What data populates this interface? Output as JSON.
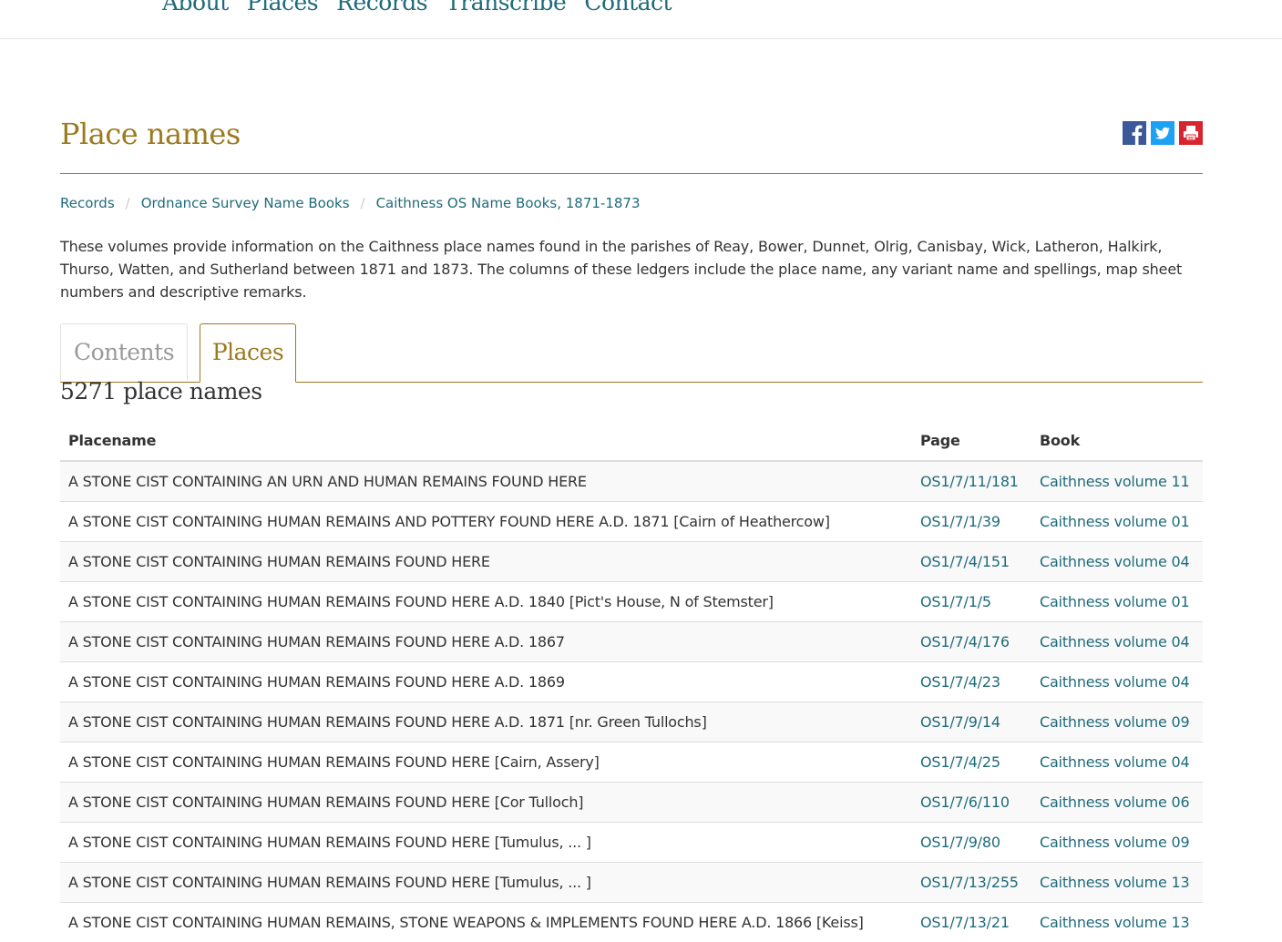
{
  "nav": [
    "About",
    "Places",
    "Records",
    "Transcribe",
    "Contact"
  ],
  "page_title": "Place names",
  "share_icons": [
    "facebook-icon",
    "twitter-icon",
    "print-icon"
  ],
  "colors": {
    "accent": "#9c7a1f",
    "link": "#1f6b7b",
    "facebook": "#3b5998",
    "twitter": "#1da1f2",
    "print": "#d9232e"
  },
  "breadcrumb": [
    "Records",
    "Ordnance Survey Name Books",
    "Caithness OS Name Books, 1871-1873"
  ],
  "intro": "These volumes provide information on the Caithness place names found in the parishes of Reay, Bower, Dunnet, Olrig, Canisbay, Wick, Latheron, Halkirk, Thurso, Watten, and Sutherland between 1871 and 1873. The columns of these ledgers include the place name, any variant name and spellings, map sheet numbers and descriptive remarks.",
  "tabs": {
    "contents": "Contents",
    "places": "Places",
    "active": "Places"
  },
  "count_label": "5271 place names",
  "table": {
    "headers": {
      "placename": "Placename",
      "page": "Page",
      "book": "Book"
    },
    "rows": [
      {
        "placename": "A STONE CIST CONTAINING AN URN AND HUMAN REMAINS FOUND HERE",
        "page": "OS1/7/11/181",
        "book": "Caithness volume 11"
      },
      {
        "placename": "A STONE CIST CONTAINING HUMAN REMAINS AND POTTERY FOUND HERE A.D. 1871 [Cairn of Heathercow]",
        "page": "OS1/7/1/39",
        "book": "Caithness volume 01"
      },
      {
        "placename": "A STONE CIST CONTAINING HUMAN REMAINS FOUND HERE",
        "page": "OS1/7/4/151",
        "book": "Caithness volume 04"
      },
      {
        "placename": "A STONE CIST CONTAINING HUMAN REMAINS FOUND HERE A.D. 1840 [Pict's House, N of Stemster]",
        "page": "OS1/7/1/5",
        "book": "Caithness volume 01"
      },
      {
        "placename": "A STONE CIST CONTAINING HUMAN REMAINS FOUND HERE A.D. 1867",
        "page": "OS1/7/4/176",
        "book": "Caithness volume 04"
      },
      {
        "placename": "A STONE CIST CONTAINING HUMAN REMAINS FOUND HERE A.D. 1869",
        "page": "OS1/7/4/23",
        "book": "Caithness volume 04"
      },
      {
        "placename": "A STONE CIST CONTAINING HUMAN REMAINS FOUND HERE A.D. 1871 [nr. Green Tullochs]",
        "page": "OS1/7/9/14",
        "book": "Caithness volume 09"
      },
      {
        "placename": "A STONE CIST CONTAINING HUMAN REMAINS FOUND HERE [Cairn, Assery]",
        "page": "OS1/7/4/25",
        "book": "Caithness volume 04"
      },
      {
        "placename": "A STONE CIST CONTAINING HUMAN REMAINS FOUND HERE [Cor Tulloch]",
        "page": "OS1/7/6/110",
        "book": "Caithness volume 06"
      },
      {
        "placename": "A STONE CIST CONTAINING HUMAN REMAINS FOUND HERE [Tumulus, ... ]",
        "page": "OS1/7/9/80",
        "book": "Caithness volume 09"
      },
      {
        "placename": "A STONE CIST CONTAINING HUMAN REMAINS FOUND HERE [Tumulus, ... ]",
        "page": "OS1/7/13/255",
        "book": "Caithness volume 13"
      },
      {
        "placename": "A STONE CIST CONTAINING HUMAN REMAINS, STONE WEAPONS & IMPLEMENTS FOUND HERE A.D. 1866 [Keiss]",
        "page": "OS1/7/13/21",
        "book": "Caithness volume 13"
      }
    ]
  }
}
